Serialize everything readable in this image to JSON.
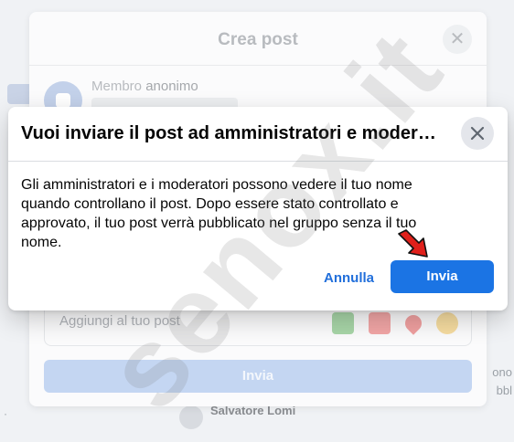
{
  "watermark": "senox.it",
  "background_feed": {
    "right_fragments": [
      "ono",
      "bbl"
    ],
    "bottom_name": "Salvatore Lomi"
  },
  "create_post": {
    "title": "Crea post",
    "member_prefix": "Membro",
    "member_name": "anonimo",
    "add_to_post_label": "Aggiungi al tuo post",
    "submit_label": "Invia"
  },
  "modal": {
    "title": "Vuoi inviare il post ad amministratori e moderatori?",
    "body": "Gli amministratori e i moderatori possono vedere il tuo nome quando controllano il post. Dopo essere stato controllato e approvato, il tuo post verrà pubblicato nel gruppo senza il tuo nome.",
    "cancel_label": "Annulla",
    "send_label": "Invia"
  },
  "colors": {
    "primary": "#1b74e4",
    "link": "#216fdb",
    "arrow": "#e0201b"
  }
}
